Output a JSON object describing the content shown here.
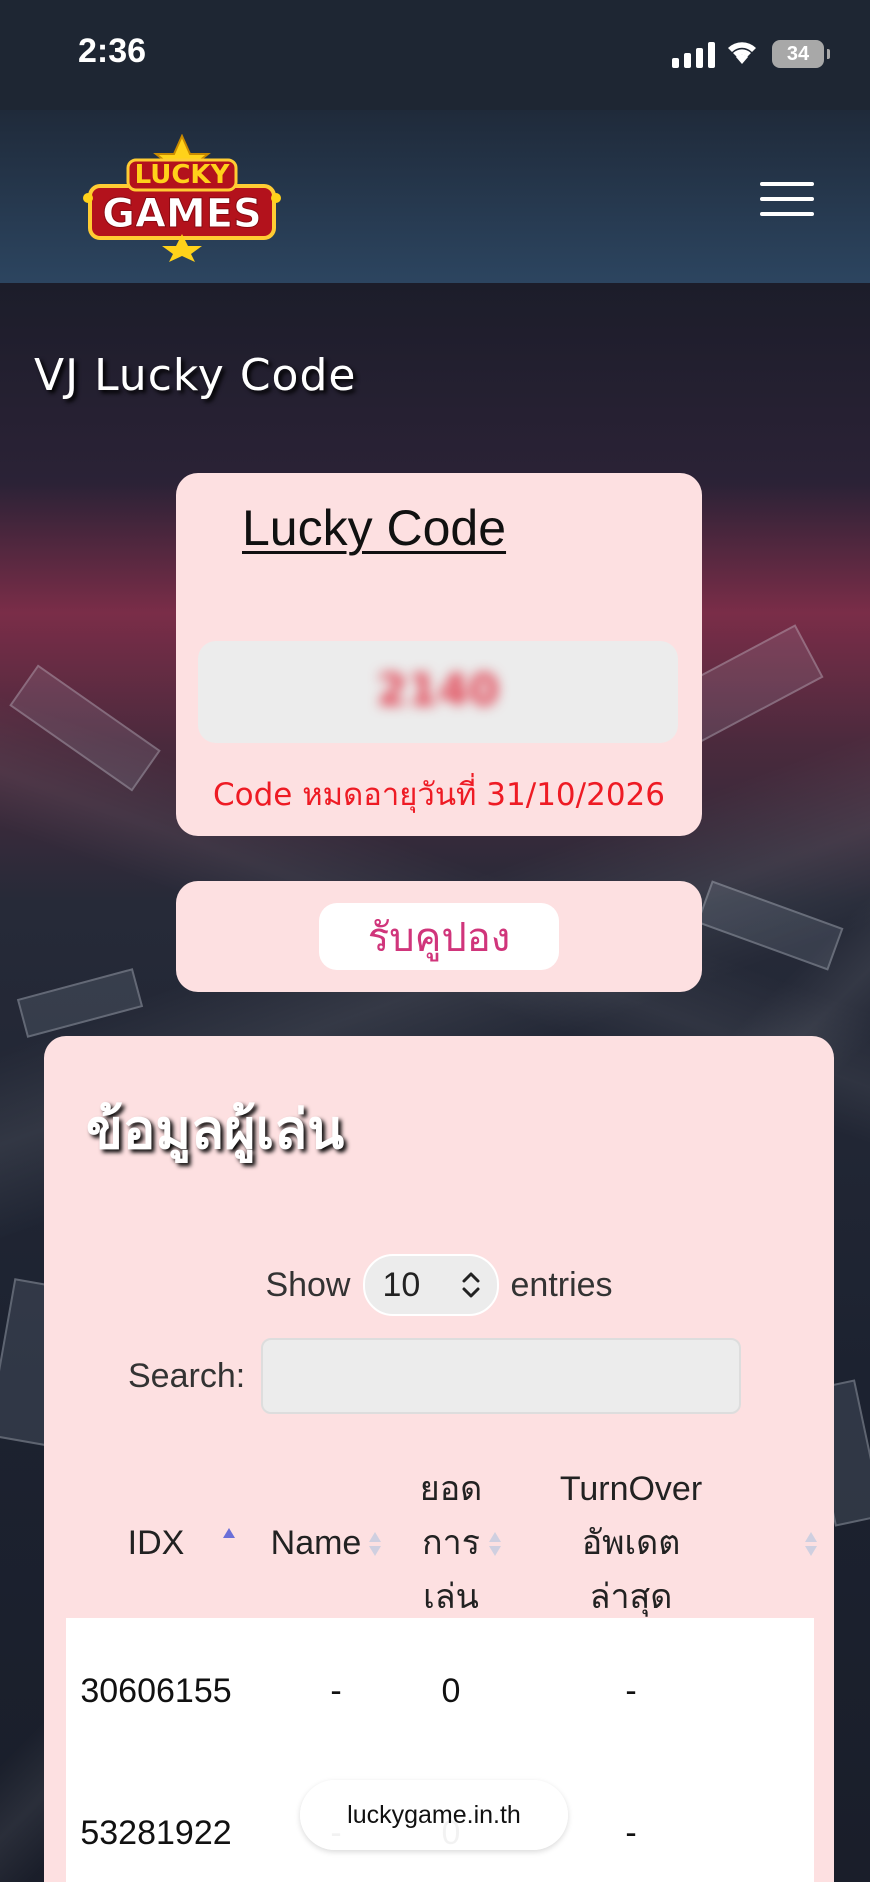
{
  "status_bar": {
    "time": "2:36",
    "battery": "34"
  },
  "header": {
    "logo_text_top": "LUCKY",
    "logo_text_bottom": "GAMES",
    "menu_icon": "hamburger-menu-icon"
  },
  "page": {
    "title": "VJ Lucky Code"
  },
  "lucky_code": {
    "title": "Lucky Code",
    "code_value": "2140",
    "expiry_text": "Code หมดอายุวันที่ 31/10/2026"
  },
  "coupon": {
    "button_label": "รับคูปอง"
  },
  "player_info": {
    "title": "ข้อมูลผู้เล่น",
    "show_label": "Show",
    "entries_value": "10",
    "entries_label": "entries",
    "search_label": "Search:",
    "search_value": "",
    "columns": [
      "IDX",
      "Name",
      "ยอด การ เล่น",
      "TurnOver อัพเดต ล่าสุด"
    ],
    "rows": [
      {
        "idx": "30606155",
        "name": "-",
        "plays": "0",
        "turnover": "-"
      },
      {
        "idx": "53281922",
        "name": "-",
        "plays": "0",
        "turnover": "-"
      }
    ]
  },
  "browser": {
    "url": "luckygame.in.th"
  },
  "colors": {
    "card_bg": "#fde0e1",
    "expiry_red": "#ee1b24",
    "coupon_pink": "#d0357b",
    "sort_active": "#6b6fd8"
  }
}
